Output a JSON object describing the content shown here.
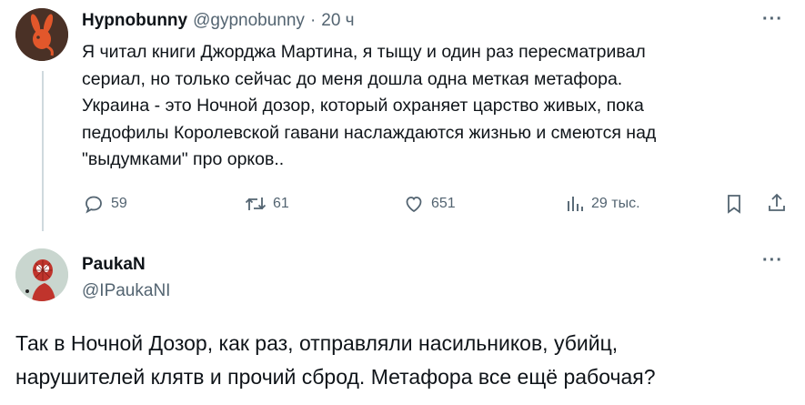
{
  "tweet": {
    "author_name": "Hypnobunny",
    "author_handle": "@gypnobunny",
    "separator": "·",
    "time": "20 ч",
    "more": "···",
    "text": "Я читал книги Джорджа Мартина, я тыщу и один раз пересматривал\nсериал, но только сейчас до меня дошла одна меткая метафора.\nУкраина - это Ночной дозор, который охраняет царство живых, пока\nпедофилы Королевской гавани наслаждаются жизнью и смеются над\n\"выдумками\" про орков..",
    "actions": {
      "replies": "59",
      "retweets": "61",
      "likes": "651",
      "views": "29 тыс."
    },
    "icons": [
      "reply-icon",
      "retweet-icon",
      "like-icon",
      "views-icon",
      "bookmark-icon",
      "share-icon"
    ]
  },
  "reply": {
    "author_name": "PaukaN",
    "author_handle": "@IPaukaNI",
    "more": "···",
    "text": "Так в Ночной Дозор, как раз, отправляли насильников, убийц,\nнарушителей клятв и прочий сброд. Метафора все ещё рабочая?"
  },
  "colors": {
    "text": "#0f1419",
    "muted": "#536471",
    "thread_line": "#cfd9de",
    "avatar_bunny": "#e2572b"
  }
}
